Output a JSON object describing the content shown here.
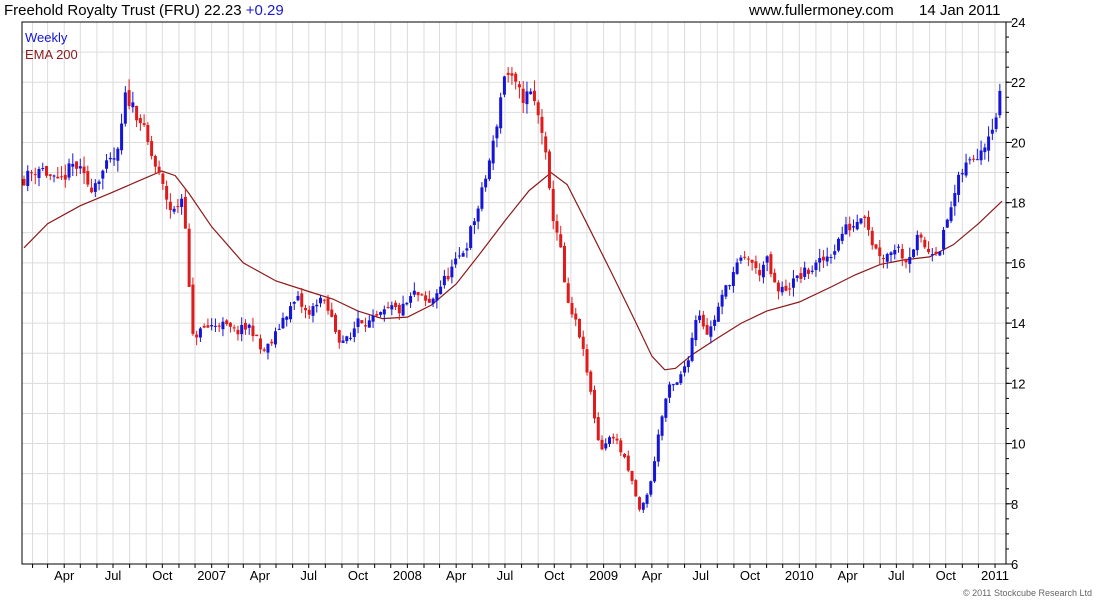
{
  "header": {
    "title": "Freehold Royalty Trust (FRU) 22.23",
    "change": "+0.29",
    "site": "www.fullermoney.com",
    "date": "14 Jan 2011"
  },
  "legend": {
    "weekly": "Weekly",
    "ema": "EMA 200"
  },
  "copyright": "© 2011 Stockcube Research Ltd",
  "colors": {
    "up": "#1515d8",
    "down": "#e01b1b",
    "ema": "#8b1a1a",
    "grid": "#dcdcdc",
    "change_text": "#1a1acc"
  },
  "chart_data": {
    "type": "candlestick",
    "ylim": [
      6,
      24
    ],
    "ytick_labels": [
      "6",
      "8",
      "10",
      "12",
      "14",
      "16",
      "18",
      "20",
      "22",
      "24"
    ],
    "x_range": [
      "2006-01-16",
      "2011-01-14"
    ],
    "x_labels": [
      {
        "date": "2006-04-01",
        "label": "Apr"
      },
      {
        "date": "2006-07-01",
        "label": "Jul"
      },
      {
        "date": "2006-10-01",
        "label": "Oct"
      },
      {
        "date": "2007-01-01",
        "label": "2007"
      },
      {
        "date": "2007-04-01",
        "label": "Apr"
      },
      {
        "date": "2007-07-01",
        "label": "Jul"
      },
      {
        "date": "2007-10-01",
        "label": "Oct"
      },
      {
        "date": "2008-01-01",
        "label": "2008"
      },
      {
        "date": "2008-04-01",
        "label": "Apr"
      },
      {
        "date": "2008-07-01",
        "label": "Jul"
      },
      {
        "date": "2008-10-01",
        "label": "Oct"
      },
      {
        "date": "2009-01-01",
        "label": "2009"
      },
      {
        "date": "2009-04-01",
        "label": "Apr"
      },
      {
        "date": "2009-07-01",
        "label": "Jul"
      },
      {
        "date": "2009-10-01",
        "label": "Oct"
      },
      {
        "date": "2010-01-01",
        "label": "2010"
      },
      {
        "date": "2010-04-01",
        "label": "Apr"
      },
      {
        "date": "2010-07-01",
        "label": "Jul"
      },
      {
        "date": "2010-10-01",
        "label": "Oct"
      },
      {
        "date": "2011-01-01",
        "label": "2011"
      }
    ],
    "series": [
      {
        "name": "Weekly",
        "kind": "candlestick",
        "close_path": [
          [
            "2006-01-16",
            18.8
          ],
          [
            "2006-02-15",
            19.2
          ],
          [
            "2006-03-20",
            18.6
          ],
          [
            "2006-04-20",
            19.3
          ],
          [
            "2006-05-20",
            18.5
          ],
          [
            "2006-06-10",
            19.0
          ],
          [
            "2006-07-10",
            19.6
          ],
          [
            "2006-07-25",
            21.6
          ],
          [
            "2006-08-20",
            20.8
          ],
          [
            "2006-09-10",
            19.6
          ],
          [
            "2006-09-30",
            18.6
          ],
          [
            "2006-10-20",
            17.6
          ],
          [
            "2006-11-10",
            18.3
          ],
          [
            "2006-11-25",
            13.5
          ],
          [
            "2006-12-15",
            13.8
          ],
          [
            "2007-01-15",
            14.0
          ],
          [
            "2007-02-15",
            13.7
          ],
          [
            "2007-03-15",
            13.9
          ],
          [
            "2007-04-05",
            13.0
          ],
          [
            "2007-04-25",
            13.4
          ],
          [
            "2007-05-15",
            14.2
          ],
          [
            "2007-06-10",
            14.8
          ],
          [
            "2007-07-01",
            14.2
          ],
          [
            "2007-07-20",
            14.9
          ],
          [
            "2007-08-10",
            14.3
          ],
          [
            "2007-08-25",
            13.5
          ],
          [
            "2007-09-15",
            13.4
          ],
          [
            "2007-10-01",
            14.2
          ],
          [
            "2007-10-20",
            14.0
          ],
          [
            "2007-11-10",
            14.2
          ],
          [
            "2007-12-01",
            14.5
          ],
          [
            "2007-12-20",
            14.4
          ],
          [
            "2008-01-15",
            15.0
          ],
          [
            "2008-02-10",
            14.6
          ],
          [
            "2008-03-01",
            15.2
          ],
          [
            "2008-04-01",
            16.0
          ],
          [
            "2008-04-20",
            16.6
          ],
          [
            "2008-05-15",
            18.0
          ],
          [
            "2008-06-10",
            20.0
          ],
          [
            "2008-07-01",
            22.4
          ],
          [
            "2008-07-15",
            22.0
          ],
          [
            "2008-08-01",
            21.5
          ],
          [
            "2008-08-20",
            21.6
          ],
          [
            "2008-09-10",
            20.3
          ],
          [
            "2008-09-25",
            17.8
          ],
          [
            "2008-10-10",
            16.8
          ],
          [
            "2008-10-25",
            14.6
          ],
          [
            "2008-11-15",
            13.8
          ],
          [
            "2008-12-05",
            12.0
          ],
          [
            "2008-12-25",
            9.8
          ],
          [
            "2009-01-20",
            10.3
          ],
          [
            "2009-02-10",
            9.4
          ],
          [
            "2009-02-25",
            8.6
          ],
          [
            "2009-03-10",
            7.7
          ],
          [
            "2009-03-30",
            8.7
          ],
          [
            "2009-04-15",
            10.5
          ],
          [
            "2009-05-01",
            11.8
          ],
          [
            "2009-05-20",
            12.0
          ],
          [
            "2009-06-10",
            13.0
          ],
          [
            "2009-06-25",
            14.5
          ],
          [
            "2009-07-15",
            13.6
          ],
          [
            "2009-08-05",
            14.6
          ],
          [
            "2009-08-20",
            15.3
          ],
          [
            "2009-09-10",
            16.0
          ],
          [
            "2009-09-30",
            16.2
          ],
          [
            "2009-10-15",
            15.6
          ],
          [
            "2009-11-01",
            16.1
          ],
          [
            "2009-11-20",
            15.0
          ],
          [
            "2009-12-10",
            15.2
          ],
          [
            "2010-01-05",
            15.6
          ],
          [
            "2010-01-25",
            15.8
          ],
          [
            "2010-02-15",
            16.1
          ],
          [
            "2010-03-05",
            16.4
          ],
          [
            "2010-03-25",
            17.1
          ],
          [
            "2010-04-15",
            17.3
          ],
          [
            "2010-05-01",
            17.8
          ],
          [
            "2010-05-20",
            16.5
          ],
          [
            "2010-06-10",
            16.2
          ],
          [
            "2010-06-30",
            16.6
          ],
          [
            "2010-07-20",
            16.1
          ],
          [
            "2010-08-10",
            16.8
          ],
          [
            "2010-08-30",
            16.4
          ],
          [
            "2010-09-20",
            16.5
          ],
          [
            "2010-10-10",
            17.8
          ],
          [
            "2010-10-30",
            19.0
          ],
          [
            "2010-11-20",
            19.5
          ],
          [
            "2010-12-10",
            19.9
          ],
          [
            "2010-12-30",
            20.8
          ],
          [
            "2011-01-07",
            21.0
          ],
          [
            "2011-01-14",
            22.23
          ]
        ]
      },
      {
        "name": "EMA 200",
        "kind": "line",
        "points": [
          [
            "2006-01-16",
            16.5
          ],
          [
            "2006-03-01",
            17.3
          ],
          [
            "2006-05-01",
            17.9
          ],
          [
            "2006-07-01",
            18.35
          ],
          [
            "2006-08-15",
            18.7
          ],
          [
            "2006-09-30",
            19.05
          ],
          [
            "2006-10-25",
            18.9
          ],
          [
            "2006-11-20",
            18.3
          ],
          [
            "2007-01-01",
            17.2
          ],
          [
            "2007-03-01",
            16.0
          ],
          [
            "2007-05-01",
            15.4
          ],
          [
            "2007-07-01",
            15.05
          ],
          [
            "2007-08-15",
            14.8
          ],
          [
            "2007-10-01",
            14.4
          ],
          [
            "2007-11-15",
            14.15
          ],
          [
            "2008-01-01",
            14.2
          ],
          [
            "2008-02-15",
            14.6
          ],
          [
            "2008-04-01",
            15.3
          ],
          [
            "2008-05-15",
            16.3
          ],
          [
            "2008-07-01",
            17.4
          ],
          [
            "2008-08-15",
            18.4
          ],
          [
            "2008-09-25",
            19.0
          ],
          [
            "2008-10-25",
            18.6
          ],
          [
            "2008-12-01",
            17.3
          ],
          [
            "2009-01-15",
            15.7
          ],
          [
            "2009-02-28",
            14.1
          ],
          [
            "2009-04-01",
            12.9
          ],
          [
            "2009-04-25",
            12.45
          ],
          [
            "2009-05-15",
            12.5
          ],
          [
            "2009-06-15",
            12.95
          ],
          [
            "2009-08-01",
            13.5
          ],
          [
            "2009-09-15",
            14.0
          ],
          [
            "2009-11-01",
            14.4
          ],
          [
            "2010-01-01",
            14.7
          ],
          [
            "2010-03-01",
            15.2
          ],
          [
            "2010-04-15",
            15.6
          ],
          [
            "2010-06-01",
            15.95
          ],
          [
            "2010-07-15",
            16.1
          ],
          [
            "2010-09-01",
            16.2
          ],
          [
            "2010-10-15",
            16.6
          ],
          [
            "2010-12-01",
            17.3
          ],
          [
            "2011-01-14",
            18.05
          ]
        ]
      }
    ]
  }
}
